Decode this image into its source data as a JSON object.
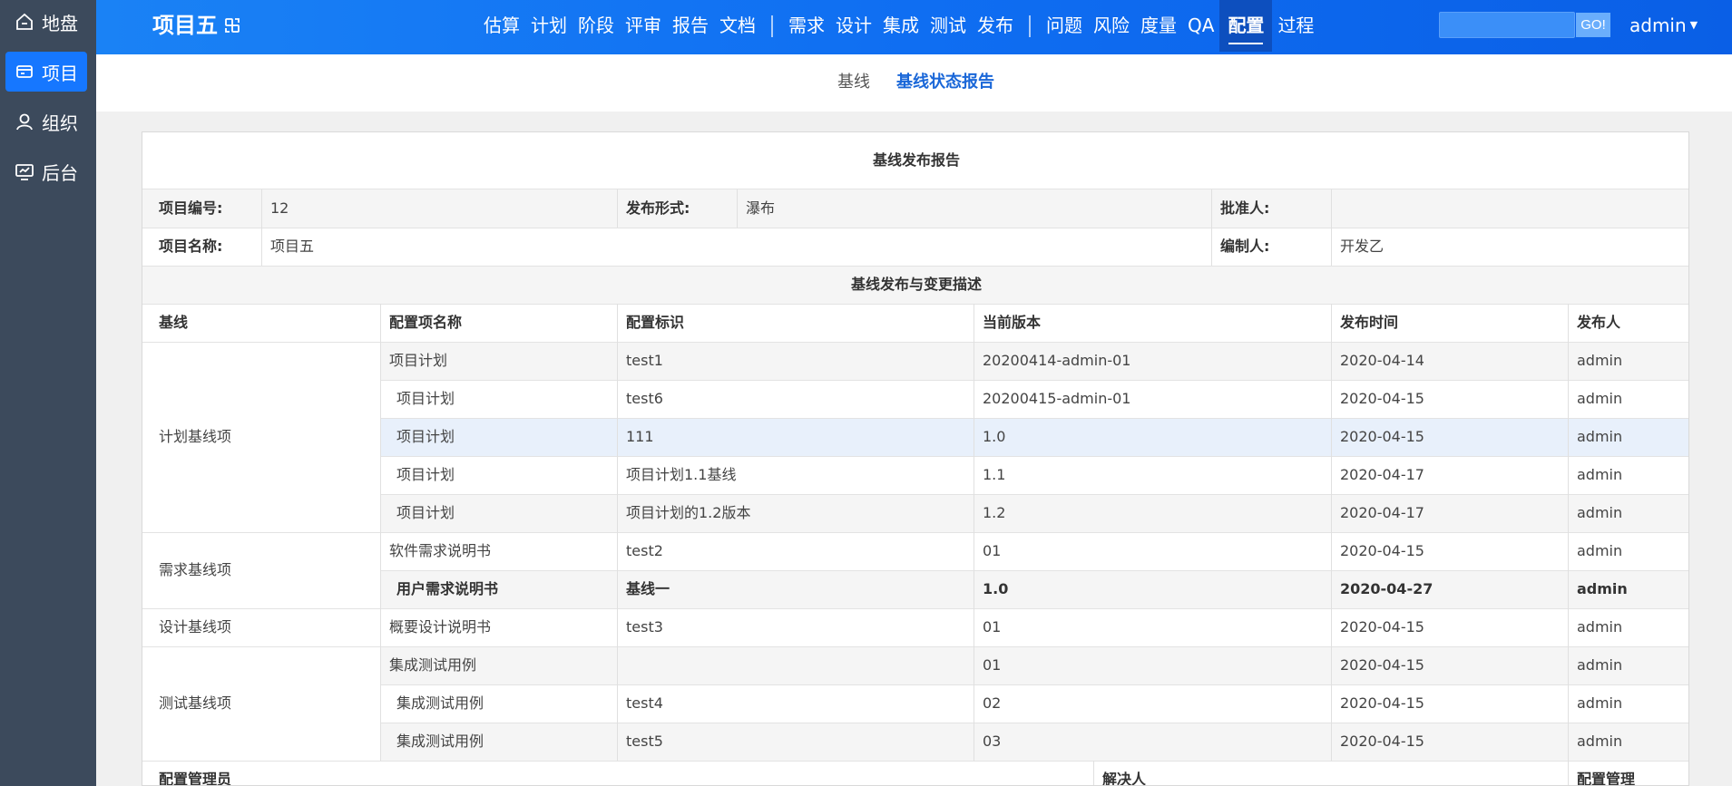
{
  "sidebar": {
    "items": [
      {
        "label": "地盘",
        "icon": "home-icon"
      },
      {
        "label": "项目",
        "icon": "project-icon",
        "active": true
      },
      {
        "label": "组织",
        "icon": "user-icon"
      },
      {
        "label": "后台",
        "icon": "monitor-icon"
      }
    ]
  },
  "header": {
    "project_title": "项目五",
    "switch_icon": "switch-project-icon",
    "nav_group1": [
      "估算",
      "计划",
      "阶段",
      "评审",
      "报告",
      "文档"
    ],
    "nav_group2": [
      "需求",
      "设计",
      "集成",
      "测试",
      "发布"
    ],
    "nav_group3": [
      "问题",
      "风险",
      "度量",
      "QA",
      "配置",
      "过程"
    ],
    "active_nav": "配置",
    "search_placeholder": "",
    "go_label": "GO!",
    "user": "admin"
  },
  "subnav": {
    "tabs": [
      {
        "label": "基线",
        "active": false
      },
      {
        "label": "基线状态报告",
        "active": true
      }
    ]
  },
  "report": {
    "title": "基线发布报告",
    "info": {
      "project_no_label": "项目编号:",
      "project_no": "12",
      "release_form_label": "发布形式:",
      "release_form": "瀑布",
      "approver_label": "批准人:",
      "approver": "",
      "project_name_label": "项目名称:",
      "project_name": "项目五",
      "editor_label": "编制人:",
      "editor": "开发乙"
    },
    "section_title": "基线发布与变更描述",
    "columns": [
      "基线",
      "配置项名称",
      "配置标识",
      "当前版本",
      "发布时间",
      "发布人"
    ],
    "groups": [
      {
        "name": "计划基线项",
        "rows": [
          {
            "item": "项目计划",
            "id": "test1",
            "version": "20200414-admin-01",
            "date": "2020-04-14",
            "publisher": "admin"
          },
          {
            "item": "项目计划",
            "id": "test6",
            "version": "20200415-admin-01",
            "date": "2020-04-15",
            "publisher": "admin"
          },
          {
            "item": "项目计划",
            "id": "111",
            "version": "1.0",
            "date": "2020-04-15",
            "publisher": "admin"
          },
          {
            "item": "项目计划",
            "id": "项目计划1.1基线",
            "version": "1.1",
            "date": "2020-04-17",
            "publisher": "admin"
          },
          {
            "item": "项目计划",
            "id": "项目计划的1.2版本",
            "version": "1.2",
            "date": "2020-04-17",
            "publisher": "admin"
          }
        ]
      },
      {
        "name": "需求基线项",
        "rows": [
          {
            "item": "软件需求说明书",
            "id": "test2",
            "version": "01",
            "date": "2020-04-15",
            "publisher": "admin"
          },
          {
            "item": "用户需求说明书",
            "id": "基线一",
            "version": "1.0",
            "date": "2020-04-27",
            "publisher": "admin"
          }
        ]
      },
      {
        "name": "设计基线项",
        "rows": [
          {
            "item": "概要设计说明书",
            "id": "test3",
            "version": "01",
            "date": "2020-04-15",
            "publisher": "admin"
          }
        ]
      },
      {
        "name": "测试基线项",
        "rows": [
          {
            "item": "集成测试用例",
            "id": "",
            "version": "01",
            "date": "2020-04-15",
            "publisher": "admin"
          },
          {
            "item": "集成测试用例",
            "id": "test4",
            "version": "02",
            "date": "2020-04-15",
            "publisher": "admin"
          },
          {
            "item": "集成测试用例",
            "id": "test5",
            "version": "03",
            "date": "2020-04-15",
            "publisher": "admin"
          }
        ]
      }
    ],
    "footer": [
      "配置管理员",
      "解决人",
      "配置管理"
    ]
  },
  "colors": {
    "header_start": "#1a82f5",
    "header_end": "#0a5fe6",
    "sidebar_bg": "#3c4a5c",
    "accent": "#1677ff",
    "row_alt": "#f5f5f5",
    "row_highlight": "#e8f0fb"
  }
}
